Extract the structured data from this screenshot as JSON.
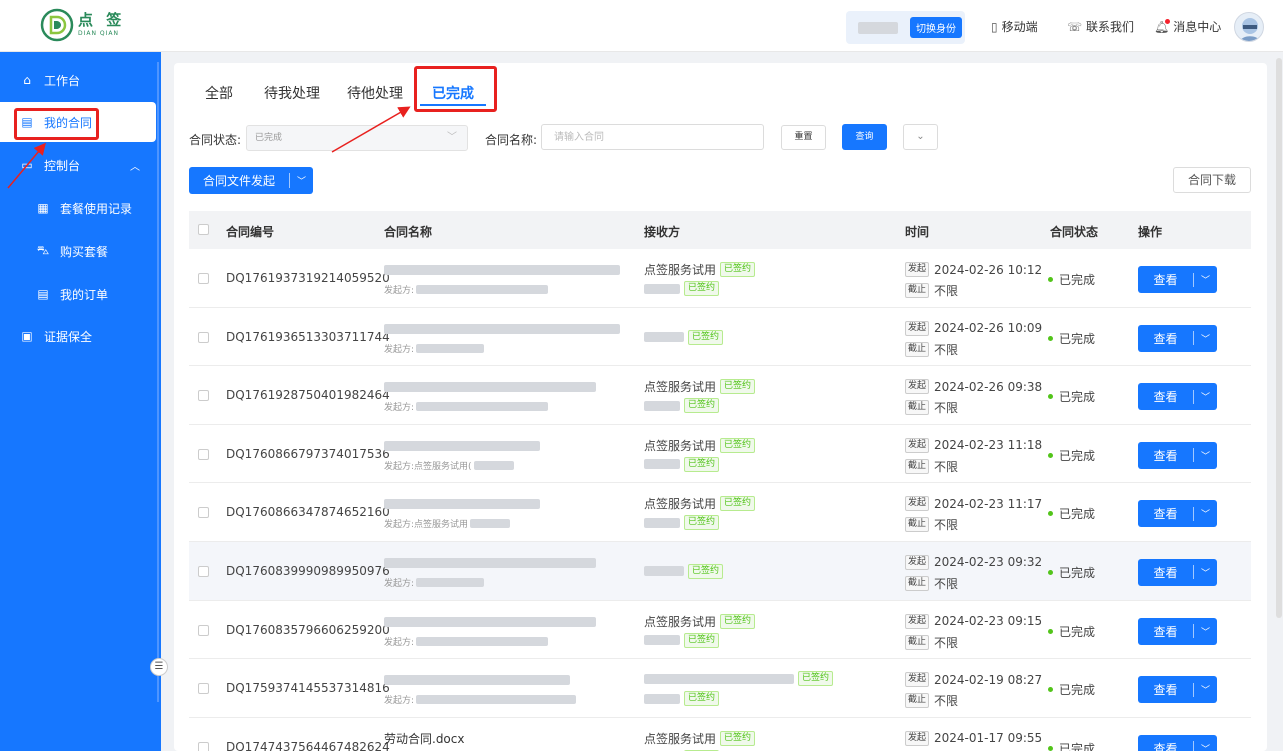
{
  "header": {
    "logo_cn": "点 签",
    "logo_en": "DIAN QIAN",
    "switch_identity": "切换身份",
    "mobile": "移动端",
    "contact": "联系我们",
    "messages": "消息中心"
  },
  "sidebar": {
    "items": [
      {
        "label": "工作台",
        "icon": "home-icon"
      },
      {
        "label": "我的合同",
        "icon": "contract-icon"
      },
      {
        "label": "控制台",
        "icon": "console-icon"
      },
      {
        "label": "套餐使用记录",
        "icon": "record-icon"
      },
      {
        "label": "购买套餐",
        "icon": "cart-icon"
      },
      {
        "label": "我的订单",
        "icon": "order-icon"
      },
      {
        "label": "证据保全",
        "icon": "evidence-icon"
      }
    ]
  },
  "tabs": [
    "全部",
    "待我处理",
    "待他处理",
    "已完成"
  ],
  "filters": {
    "status_label": "合同状态:",
    "status_value": "已完成",
    "name_label": "合同名称:",
    "name_placeholder": "请输入合同",
    "reset": "重置",
    "query": "查询"
  },
  "actions": {
    "launch": "合同文件发起",
    "download": "合同下载"
  },
  "table": {
    "headers": [
      "合同编号",
      "合同名称",
      "接收方",
      "时间",
      "合同状态",
      "操作"
    ],
    "sender_prefix": "发起方:",
    "signed": "已签约",
    "start_tag": "发起",
    "end_tag": "截止",
    "end_value": "不限",
    "view": "查看",
    "rows": [
      {
        "code": "DQ1761937319214059520",
        "name": "",
        "sender": "",
        "r1": "点签服务试用",
        "r2": "",
        "time": "2024-02-26 10:12",
        "status": "已完成"
      },
      {
        "code": "DQ1761936513303711744",
        "name": "",
        "sender": "",
        "r1": "",
        "r2": null,
        "time": "2024-02-26 10:09",
        "status": "已完成"
      },
      {
        "code": "DQ1761928750401982464",
        "name": "",
        "sender": "",
        "r1": "点签服务试用",
        "r2": "",
        "time": "2024-02-26 09:38",
        "status": "已完成"
      },
      {
        "code": "DQ1760866797374017536",
        "name": "",
        "sender": "点签服务试用(",
        "r1": "点签服务试用",
        "r2": "",
        "time": "2024-02-23 11:18",
        "status": "已完成"
      },
      {
        "code": "DQ1760866347874652160",
        "name": "",
        "sender": "点签服务试用",
        "r1": "点签服务试用",
        "r2": "",
        "time": "2024-02-23 11:17",
        "status": "已完成"
      },
      {
        "code": "DQ1760839990989950976",
        "name": "",
        "sender": "",
        "r1": "",
        "r2": null,
        "time": "2024-02-23 09:32",
        "status": "已完成"
      },
      {
        "code": "DQ1760835796606259200",
        "name": "",
        "sender": "",
        "r1": "点签服务试用",
        "r2": "",
        "time": "2024-02-23 09:15",
        "status": "已完成"
      },
      {
        "code": "DQ1759374145537314816",
        "name": "",
        "sender": "",
        "r1": "",
        "r2": "",
        "time": "2024-02-19 08:27",
        "status": "已完成"
      },
      {
        "code": "DQ1747437564467482624",
        "name": "劳动合同.docx",
        "sender": "",
        "r1": "点签服务试用",
        "r2": "",
        "time": "2024-01-17 09:55",
        "status": "已完成"
      }
    ]
  },
  "colors": {
    "primary": "#1677ff",
    "success": "#52c41a",
    "annotation": "#e8211f",
    "logo": "#2a8a5a"
  }
}
